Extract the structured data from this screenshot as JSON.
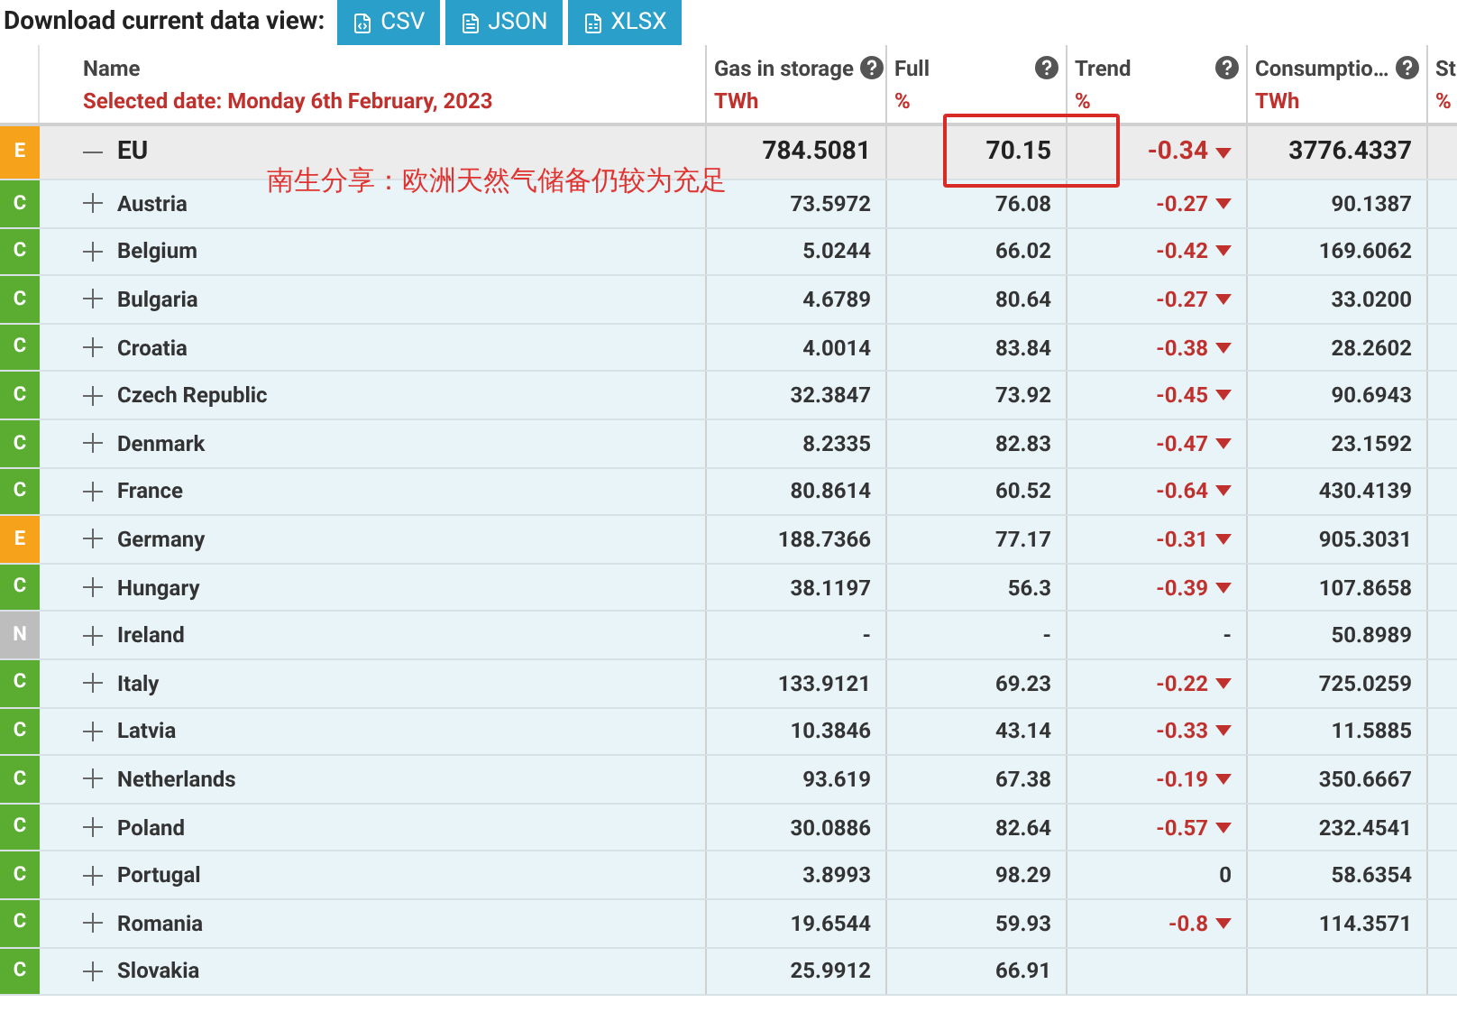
{
  "toolbar": {
    "label": "Download current data view:",
    "buttons": [
      {
        "label": "CSV"
      },
      {
        "label": "JSON"
      },
      {
        "label": "XLSX"
      }
    ]
  },
  "columns": [
    {
      "label": "Name",
      "unit": "Selected date: Monday 6th February, 2023",
      "help": false
    },
    {
      "label": "Gas in storage",
      "unit": "TWh",
      "help": true
    },
    {
      "label": "Full",
      "unit": "%",
      "help": true
    },
    {
      "label": "Trend",
      "unit": "%",
      "help": true
    },
    {
      "label": "Consumptio…",
      "unit": "TWh",
      "help": true
    },
    {
      "label": "St",
      "unit": "%"
    }
  ],
  "total": {
    "badge": "E",
    "color": "#f7a21b",
    "name": "EU",
    "expanded": true,
    "gas": "784.5081",
    "full": "70.15",
    "trend": "-0.34",
    "arrow": true,
    "consumption": "3776.4337"
  },
  "rows": [
    {
      "badge": "C",
      "color": "#5aad30",
      "name": "Austria",
      "gas": "73.5972",
      "full": "76.08",
      "trend": "-0.27",
      "arrow": true,
      "consumption": "90.1387"
    },
    {
      "badge": "C",
      "color": "#5aad30",
      "name": "Belgium",
      "gas": "5.0244",
      "full": "66.02",
      "trend": "-0.42",
      "arrow": true,
      "consumption": "169.6062"
    },
    {
      "badge": "C",
      "color": "#5aad30",
      "name": "Bulgaria",
      "gas": "4.6789",
      "full": "80.64",
      "trend": "-0.27",
      "arrow": true,
      "consumption": "33.0200"
    },
    {
      "badge": "C",
      "color": "#5aad30",
      "name": "Croatia",
      "gas": "4.0014",
      "full": "83.84",
      "trend": "-0.38",
      "arrow": true,
      "consumption": "28.2602"
    },
    {
      "badge": "C",
      "color": "#5aad30",
      "name": "Czech Republic",
      "gas": "32.3847",
      "full": "73.92",
      "trend": "-0.45",
      "arrow": true,
      "consumption": "90.6943"
    },
    {
      "badge": "C",
      "color": "#5aad30",
      "name": "Denmark",
      "gas": "8.2335",
      "full": "82.83",
      "trend": "-0.47",
      "arrow": true,
      "consumption": "23.1592"
    },
    {
      "badge": "C",
      "color": "#5aad30",
      "name": "France",
      "gas": "80.8614",
      "full": "60.52",
      "trend": "-0.64",
      "arrow": true,
      "consumption": "430.4139"
    },
    {
      "badge": "E",
      "color": "#f7a21b",
      "name": "Germany",
      "gas": "188.7366",
      "full": "77.17",
      "trend": "-0.31",
      "arrow": true,
      "consumption": "905.3031"
    },
    {
      "badge": "C",
      "color": "#5aad30",
      "name": "Hungary",
      "gas": "38.1197",
      "full": "56.3",
      "trend": "-0.39",
      "arrow": true,
      "consumption": "107.8658"
    },
    {
      "badge": "N",
      "color": "#bdbdbd",
      "name": "Ireland",
      "gas": "-",
      "full": "-",
      "trend": "-",
      "arrow": false,
      "consumption": "50.8989"
    },
    {
      "badge": "C",
      "color": "#5aad30",
      "name": "Italy",
      "gas": "133.9121",
      "full": "69.23",
      "trend": "-0.22",
      "arrow": true,
      "consumption": "725.0259"
    },
    {
      "badge": "C",
      "color": "#5aad30",
      "name": "Latvia",
      "gas": "10.3846",
      "full": "43.14",
      "trend": "-0.33",
      "arrow": true,
      "consumption": "11.5885"
    },
    {
      "badge": "C",
      "color": "#5aad30",
      "name": "Netherlands",
      "gas": "93.619",
      "full": "67.38",
      "trend": "-0.19",
      "arrow": true,
      "consumption": "350.6667"
    },
    {
      "badge": "C",
      "color": "#5aad30",
      "name": "Poland",
      "gas": "30.0886",
      "full": "82.64",
      "trend": "-0.57",
      "arrow": true,
      "consumption": "232.4541"
    },
    {
      "badge": "C",
      "color": "#5aad30",
      "name": "Portugal",
      "gas": "3.8993",
      "full": "98.29",
      "trend": "0",
      "arrow": false,
      "consumption": "58.6354"
    },
    {
      "badge": "C",
      "color": "#5aad30",
      "name": "Romania",
      "gas": "19.6544",
      "full": "59.93",
      "trend": "-0.8",
      "arrow": true,
      "consumption": "114.3571"
    },
    {
      "badge": "C",
      "color": "#5aad30",
      "name": "Slovakia",
      "gas": "25.9912",
      "full": "66.91"
    }
  ],
  "annotation": {
    "text": "南生分享：欧洲天然气储备仍较为充足",
    "highlight": true
  }
}
